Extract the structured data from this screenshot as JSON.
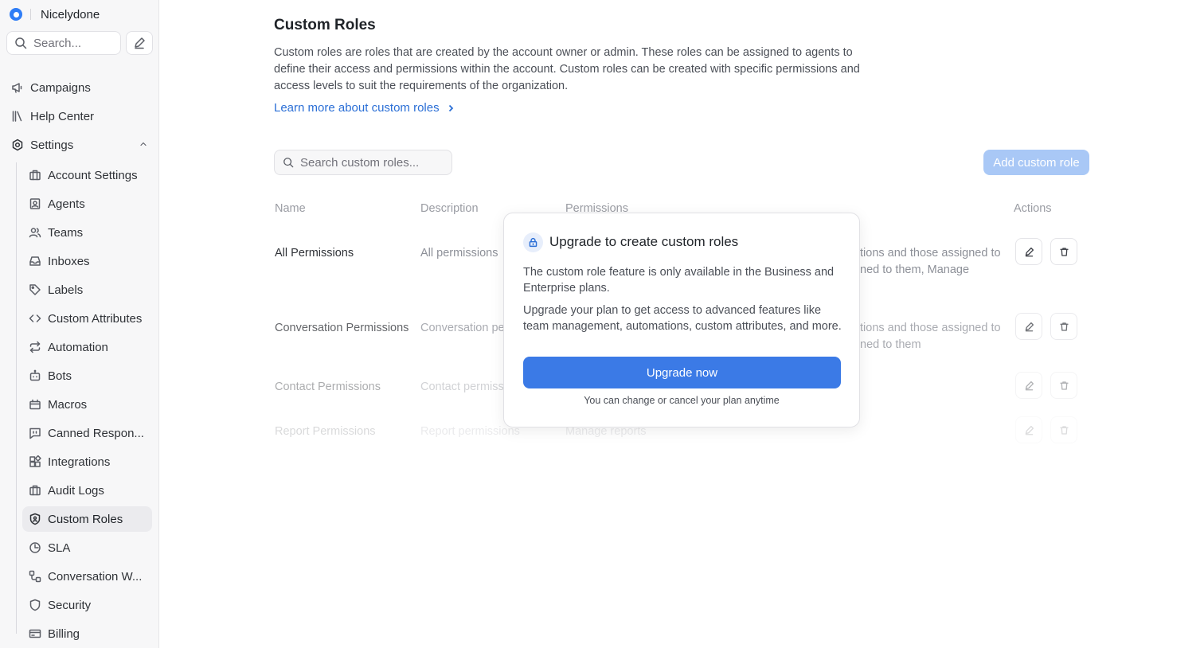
{
  "brand": {
    "name": "Nicelydone"
  },
  "sidebar": {
    "search_placeholder": "Search...",
    "top_items": [
      {
        "label": "Campaigns",
        "icon": "megaphone-icon"
      },
      {
        "label": "Help Center",
        "icon": "library-icon"
      },
      {
        "label": "Settings",
        "icon": "settings-icon",
        "expanded": true
      }
    ],
    "settings_items": [
      {
        "label": "Account Settings",
        "icon": "briefcase-icon"
      },
      {
        "label": "Agents",
        "icon": "contact-card-icon"
      },
      {
        "label": "Teams",
        "icon": "people-icon"
      },
      {
        "label": "Inboxes",
        "icon": "inbox-icon"
      },
      {
        "label": "Labels",
        "icon": "tag-icon"
      },
      {
        "label": "Custom Attributes",
        "icon": "code-icon"
      },
      {
        "label": "Automation",
        "icon": "repeat-icon"
      },
      {
        "label": "Bots",
        "icon": "bot-icon"
      },
      {
        "label": "Macros",
        "icon": "macros-icon"
      },
      {
        "label": "Canned Respon...",
        "icon": "chat-quote-icon"
      },
      {
        "label": "Integrations",
        "icon": "apps-icon"
      },
      {
        "label": "Audit Logs",
        "icon": "briefcase-icon"
      },
      {
        "label": "Custom Roles",
        "icon": "shield-user-icon",
        "active": true
      },
      {
        "label": "SLA",
        "icon": "clock-pie-icon"
      },
      {
        "label": "Conversation W...",
        "icon": "workflow-icon"
      },
      {
        "label": "Security",
        "icon": "shield-icon"
      },
      {
        "label": "Billing",
        "icon": "credit-card-icon"
      }
    ]
  },
  "page": {
    "title": "Custom Roles",
    "description": "Custom roles are roles that are created by the account owner or admin. These roles can be assigned to agents to define their access and permissions within the account. Custom roles can be created with specific permissions and access levels to suit the requirements of the organization.",
    "learn_more": "Learn more about custom roles",
    "search_placeholder": "Search custom roles...",
    "add_button": "Add custom role"
  },
  "table": {
    "headers": {
      "name": "Name",
      "description": "Description",
      "permissions": "Permissions",
      "actions": "Actions"
    },
    "rows": [
      {
        "name": "All Permissions",
        "description": "All permissions",
        "perm_line1": "tions and those assigned to",
        "perm_line2": "ned to them, Manage"
      },
      {
        "name": "Conversation Permissions",
        "description": "Conversation pe",
        "perm_line1": "tions and those assigned to",
        "perm_line2": "ned to them"
      },
      {
        "name": "Contact Permissions",
        "description": "Contact permiss",
        "perm_line1": "",
        "perm_line2": ""
      },
      {
        "name": "Report Permissions",
        "description": "Report permissions",
        "perm_line1": "Manage reports",
        "perm_line2": ""
      }
    ]
  },
  "modal": {
    "title": "Upgrade to create custom roles",
    "paragraph1": "The custom role feature is only available in the Business and Enterprise plans.",
    "paragraph2": "Upgrade your plan to get access to advanced features like team management, automations, custom attributes, and more.",
    "button": "Upgrade now",
    "note": "You can change or cancel your plan anytime"
  },
  "colors": {
    "accent": "#3b7ae6",
    "link": "#2b6fd6",
    "add_button_disabled": "#a9c8f6",
    "active_item_bg": "#ebebee"
  }
}
